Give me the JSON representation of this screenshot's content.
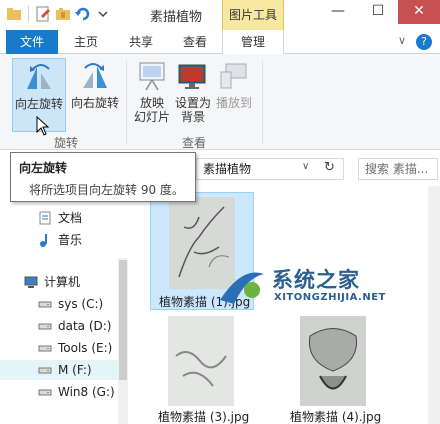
{
  "window": {
    "title": "素描植物",
    "context_tab_header": "图片工具",
    "controls": {
      "minimize": "—",
      "maximize": "☐",
      "close": "✕"
    }
  },
  "ribbon_tabs": {
    "file": "文件",
    "home": "主页",
    "share": "共享",
    "view": "查看",
    "manage": "管理"
  },
  "ribbon": {
    "rotate_left": "向左旋转",
    "rotate_right": "向右旋转",
    "rotate_group": "旋转",
    "slideshow_l1": "放映",
    "slideshow_l2": "幻灯片",
    "set_bg_l1": "设置为",
    "set_bg_l2": "背景",
    "cast": "播放到",
    "view_group": "查看"
  },
  "address": {
    "path": "素描植物"
  },
  "search": {
    "placeholder": "搜索 素描..."
  },
  "tooltip": {
    "title": "向左旋转",
    "description": "将所选项目向左旋转 90 度。"
  },
  "nav": {
    "items": [
      {
        "label": "文档",
        "icon": "document-icon"
      },
      {
        "label": "音乐",
        "icon": "music-icon"
      },
      {
        "label": "计算机",
        "icon": "computer-icon"
      },
      {
        "label": "sys (C:)",
        "icon": "drive-icon"
      },
      {
        "label": "data (D:)",
        "icon": "drive-icon"
      },
      {
        "label": "Tools (E:)",
        "icon": "drive-icon"
      },
      {
        "label": "M (F:)",
        "icon": "drive-icon"
      },
      {
        "label": "Win8 (G:)",
        "icon": "drive-icon"
      }
    ]
  },
  "files": [
    {
      "name": "植物素描 (1).jpg"
    },
    {
      "name": "植物素描 (3).jpg"
    },
    {
      "name": "植物素描 (4).jpg"
    }
  ],
  "watermark": {
    "cn": "系统之家",
    "en": "XITONGZHIJIA.NET"
  },
  "colors": {
    "accent": "#1979ca",
    "context_tab": "#f8e7a1",
    "selection": "#cce8ff",
    "close": "#c75050"
  }
}
